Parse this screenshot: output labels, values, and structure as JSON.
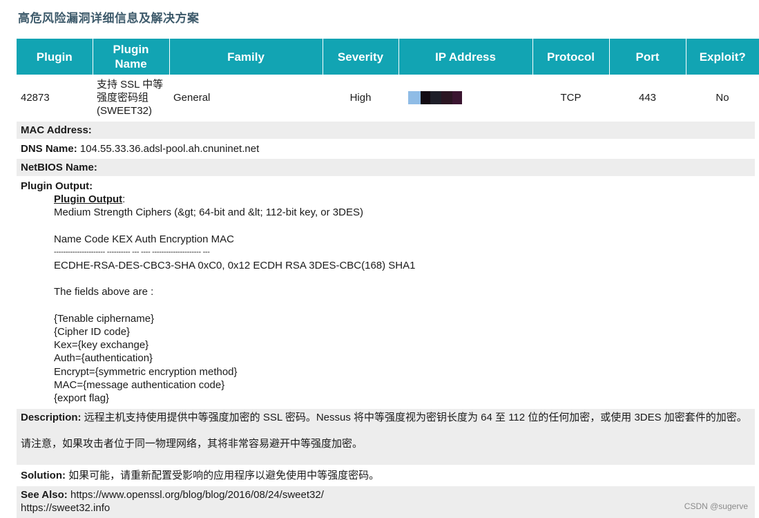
{
  "title": "高危风险漏洞详细信息及解决方案",
  "table": {
    "headers": [
      "Plugin",
      "Plugin Name",
      "Family",
      "Severity",
      "IP Address",
      "Protocol",
      "Port",
      "Exploit?"
    ],
    "row": {
      "plugin": "42873",
      "plugin_name": "支持 SSL 中等强度密码组 (SWEET32)",
      "family": "General",
      "severity": "High",
      "ip_redacted_colors": [
        "#8fbce6",
        "#120a12",
        "#1e1e28",
        "#2a1622",
        "#3a1530"
      ],
      "protocol": "TCP",
      "port": "443",
      "exploit": "No"
    }
  },
  "mac": {
    "label": "MAC Address:",
    "value": ""
  },
  "dns": {
    "label": "DNS Name:",
    "value": "104.55.33.36.adsl-pool.ah.cnuninet.net"
  },
  "netbios": {
    "label": "NetBIOS Name:",
    "value": ""
  },
  "plugin_output": {
    "label": "Plugin Output:",
    "inner_heading": "Plugin Output",
    "inner_colon": ":",
    "lines": [
      "Medium Strength Ciphers (&gt; 64-bit and &lt; 112-bit key, or 3DES)",
      "",
      "Name Code KEX Auth Encryption MAC",
      "---------------------- ---------- --- ---- --------------------- ---",
      "ECDHE-RSA-DES-CBC3-SHA 0xC0, 0x12 ECDH RSA 3DES-CBC(168) SHA1",
      "",
      "The fields above are :",
      "",
      "{Tenable ciphername}",
      "{Cipher ID code}",
      "Kex={key exchange}",
      "Auth={authentication}",
      "Encrypt={symmetric encryption method}",
      "MAC={message authentication code}",
      "{export flag}"
    ]
  },
  "description": {
    "label": "Description:",
    "text": " 远程主机支持使用提供中等强度加密的 SSL 密码。Nessus 将中等强度视为密钥长度为 64 至 112 位的任何加密，或使用 3DES 加密套件的加密。",
    "note": "请注意，如果攻击者位于同一物理网络，其将非常容易避开中等强度加密。"
  },
  "solution": {
    "label": "Solution:",
    "text": " 如果可能，请重新配置受影响的应用程序以避免使用中等强度密码。"
  },
  "see_also": {
    "label": "See Also:",
    "url1": " https://www.openssl.org/blog/blog/2016/08/24/sweet32/",
    "url2": "https://sweet32.info"
  },
  "watermark": "CSDN @sugerve"
}
